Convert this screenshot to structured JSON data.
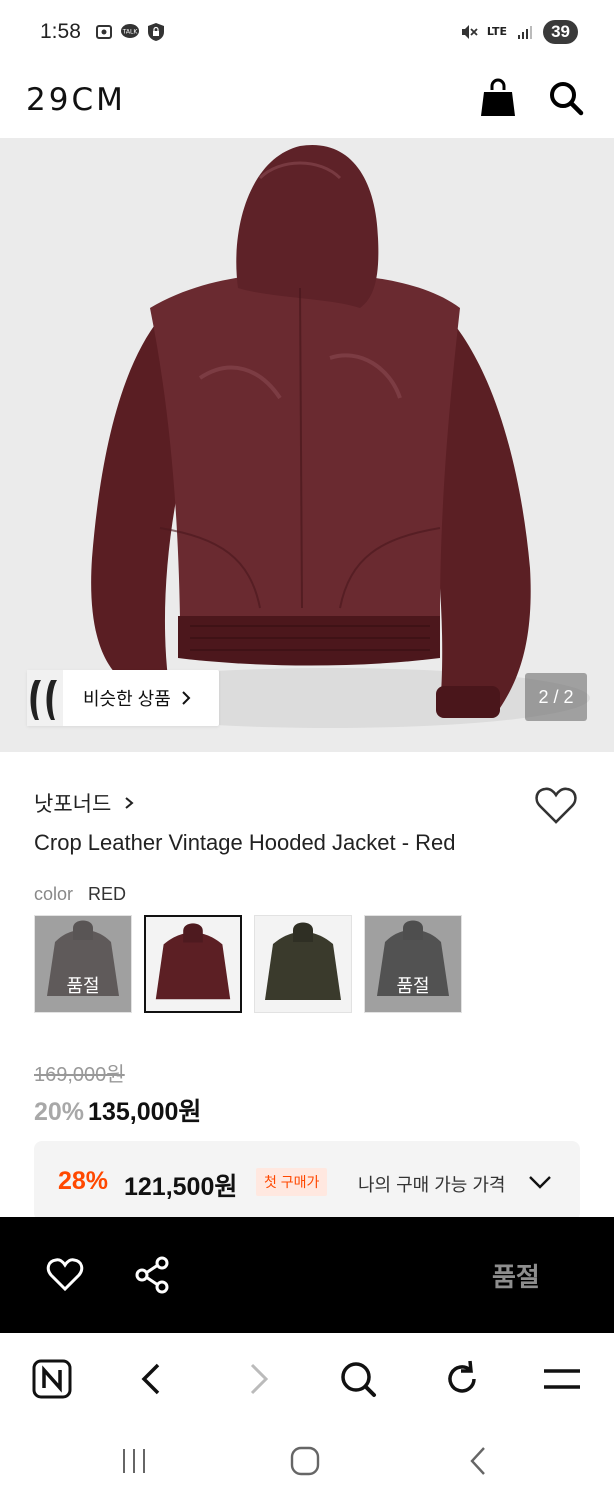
{
  "status_bar": {
    "time": "1:58",
    "network": "LTE",
    "battery": "39",
    "icons": [
      "screenshot-icon",
      "talk-icon",
      "vpn-lock-icon",
      "mute-icon",
      "signal-icon"
    ]
  },
  "header": {
    "logo": "29CM",
    "icons": [
      "shopping-bag-icon",
      "search-icon"
    ]
  },
  "hero": {
    "similar_label": "비슷한 상품",
    "counter": "2 / 2"
  },
  "product": {
    "brand": "낫포너드",
    "title": "Crop Leather Vintage Hooded Jacket - Red",
    "color_label": "color",
    "color_value": "RED",
    "swatches": [
      {
        "tone": "#5a4e4e",
        "sold_out": "품절"
      },
      {
        "tone": "#5c1f24",
        "sold_out": ""
      },
      {
        "tone": "#3a3a2c",
        "sold_out": ""
      },
      {
        "tone": "#3c3c3c",
        "sold_out": "품절"
      }
    ],
    "original_price": "169,000원",
    "discount": "20%",
    "price": "135,000원"
  },
  "coupon": {
    "discount": "28%",
    "price": "121,500원",
    "badge": "첫 구매가",
    "text": "나의 구매 가능 가격"
  },
  "action_bar": {
    "sold_out": "품절"
  },
  "colors": {
    "accent": "#ff4800",
    "jacket": "#5e2025",
    "hero_bg": "#ebebeb"
  }
}
